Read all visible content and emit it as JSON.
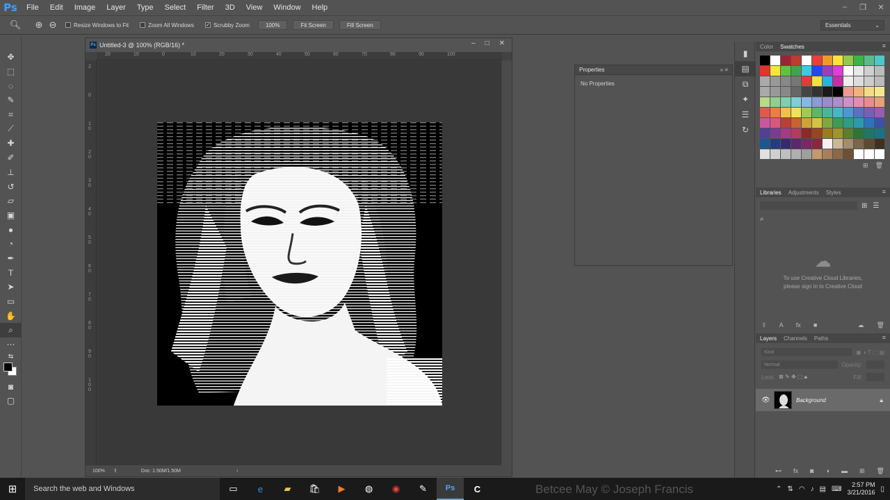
{
  "app": {
    "logo": "Ps",
    "menu": [
      "File",
      "Edit",
      "Image",
      "Layer",
      "Type",
      "Select",
      "Filter",
      "3D",
      "View",
      "Window",
      "Help"
    ],
    "window_controls": [
      "–",
      "❐",
      "✕"
    ]
  },
  "options": {
    "resize_windows": "Resize Windows to Fit",
    "zoom_all": "Zoom All Windows",
    "scrubby_zoom": "Scrubby Zoom",
    "zoom_value": "100%",
    "fit_screen": "Fit Screen",
    "fill_screen": "Fill Screen",
    "workspace": "Essentials"
  },
  "document": {
    "title": "Untitled-3 @ 100% (RGB/16) *",
    "ruler_top": [
      "20",
      "10",
      "0",
      "10",
      "20",
      "30",
      "40",
      "50",
      "60",
      "70",
      "80",
      "90",
      "100"
    ],
    "ruler_left": [
      "2",
      "0",
      "1 0",
      "2 0",
      "3 0",
      "4 0",
      "5 0",
      "6 0",
      "7 0",
      "8 0",
      "9 0",
      "1 0 0"
    ],
    "status_zoom": "100%",
    "status_doc": "Doc: 1.50M/1.50M"
  },
  "properties": {
    "title": "Properties",
    "content": "No Properties"
  },
  "swatches_panel": {
    "tabs": [
      "Color",
      "Swatches"
    ],
    "colors": [
      "#000000",
      "#ffffff",
      "#9b2335",
      "#c0392b",
      "#ffffff",
      "#e8413a",
      "#f09a2a",
      "#ffe23d",
      "#95c94d",
      "#3bb54a",
      "#5bbb8c",
      "#4fc7c7",
      "#e7312a",
      "#f7e43d",
      "#60c23c",
      "#3ea64a",
      "#3dc8e8",
      "#2547f2",
      "#9a3ec0",
      "#e13bdc",
      "#ffffff",
      "#e8e8e8",
      "#cfcfcf",
      "#bcbcbc",
      "#aaaaaa",
      "#999999",
      "#888888",
      "#777777",
      "#e13a3a",
      "#f0e23b",
      "#2ab0e6",
      "#c42ea6",
      "#eeeeee",
      "#dddddd",
      "#cccccc",
      "#bbbbbb",
      "#aaaaaa",
      "#999999",
      "#888888",
      "#666666",
      "#444444",
      "#333333",
      "#1a1a1a",
      "#000000",
      "#ef9a90",
      "#f0b47a",
      "#f4dc82",
      "#f2e98e",
      "#b9d987",
      "#90cf8d",
      "#7fcfb0",
      "#7ecfd6",
      "#87b7e4",
      "#8a9bd6",
      "#9a8ccb",
      "#b08cc9",
      "#d18fc6",
      "#e58db1",
      "#e78e8d",
      "#e6a07a",
      "#e05a4b",
      "#e8803f",
      "#f0c14a",
      "#ede35a",
      "#9ccb5b",
      "#5bb76a",
      "#47b79c",
      "#45b7c6",
      "#4e97d6",
      "#5a70c4",
      "#7461b5",
      "#9a5cb2",
      "#c9579f",
      "#d9577c",
      "#b84036",
      "#c9632e",
      "#cfa236",
      "#d3c440",
      "#7ea941",
      "#3e9c50",
      "#2f9c85",
      "#2a9bad",
      "#2a74bd",
      "#3a53a8",
      "#523f97",
      "#7a3c93",
      "#a63a84",
      "#b53a5e",
      "#8c2a24",
      "#99461e",
      "#9c7a20",
      "#a19527",
      "#5c7f2c",
      "#2a7639",
      "#1e7766",
      "#1a7384",
      "#1c5691",
      "#263c80",
      "#372b70",
      "#58296d",
      "#7b2762",
      "#872742",
      "#f2f2f2",
      "#c8b79a",
      "#a48d6c",
      "#7c6649",
      "#5d4a33",
      "#3e3120",
      "#e0e0e0",
      "#cfcfcf",
      "#bfbfbf",
      "#afafaf",
      "#9f9f9f",
      "#c39a6b",
      "#a7805a",
      "#8b6847",
      "#6f5035",
      "#ffffff",
      "#ffffff",
      "#ffffff"
    ]
  },
  "libraries": {
    "tabs": [
      "Libraries",
      "Adjustments",
      "Styles"
    ],
    "message_line1": "To use Creative Cloud Libraries,",
    "message_line2": "please sign in to Creative Cloud"
  },
  "layers": {
    "tabs": [
      "Layers",
      "Channels",
      "Paths"
    ],
    "kind": "Kind",
    "blend": "Normal",
    "opacity_label": "Opacity:",
    "lock_label": "Lock:",
    "fill_label": "Fill:",
    "layer_name": "Background"
  },
  "taskbar": {
    "search_placeholder": "Search the web and Windows",
    "watermark": "Betcee May © Joseph Francis",
    "time": "2:57 PM",
    "date": "3/21/2016"
  }
}
